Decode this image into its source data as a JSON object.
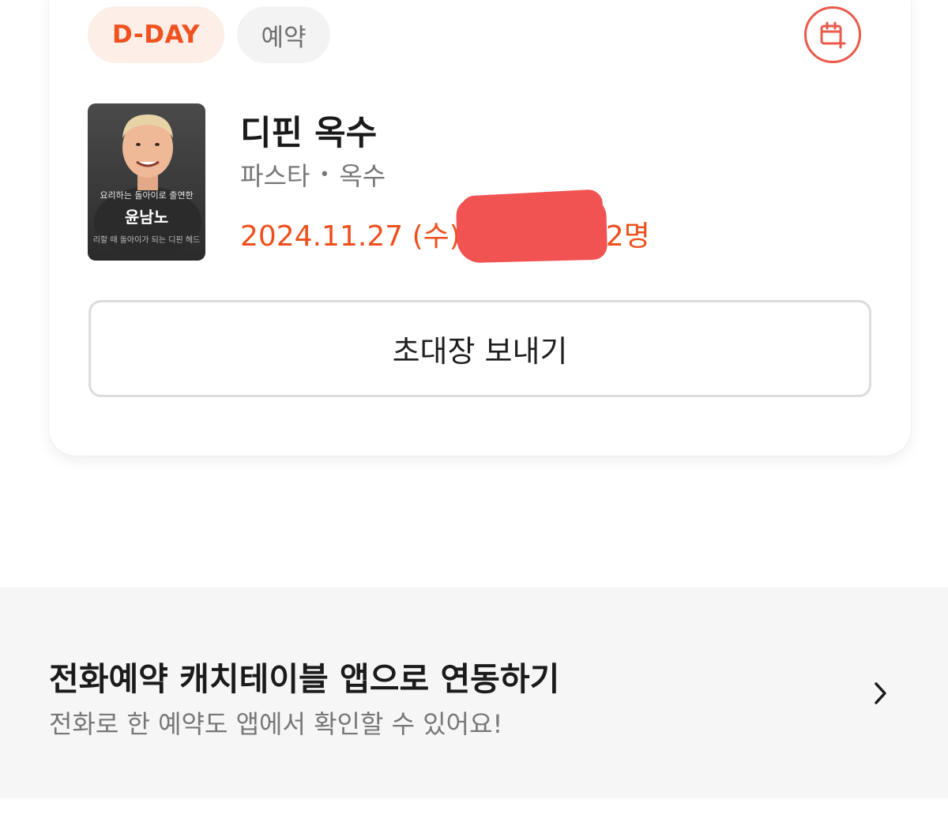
{
  "reservation": {
    "badge_dday": "D-DAY",
    "badge_type": "예약",
    "calendar_icon": "calendar-add-icon",
    "thumbnail": {
      "caption_top": "요리하는 돌아이로 출연한",
      "name": "윤남노",
      "caption_bottom": "리할 때 돌아이가 되는 디핀 헤드"
    },
    "restaurant_name": "디핀 옥수",
    "category": "파스타",
    "separator": "•",
    "location": "옥수",
    "date": "2024.11.27 (수)",
    "party": "2명",
    "invite_button": "초대장 보내기"
  },
  "phone_link_banner": {
    "title": "전화예약 캐치테이블 앱으로 연동하기",
    "subtitle": "전화로 한 예약도 앱에서 확인할 수 있어요!",
    "arrow_icon": "chevron-right-icon"
  },
  "colors": {
    "accent": "#ef4f1d",
    "badge_bg": "#fdeee8",
    "redaction": "#f15353",
    "banner_bg": "#f6f6f6"
  }
}
